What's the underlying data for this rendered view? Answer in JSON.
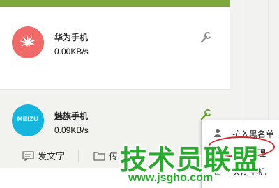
{
  "colors": {
    "accent_green": "#7fa83c",
    "huawei_red": "#f06a6a",
    "meizu_blue": "#15b5de",
    "highlight_red": "#d7262a",
    "watermark_green": "#2aa82f"
  },
  "devices": [
    {
      "name": "华为手机",
      "speed": "0.00KB/s",
      "logo_text": "",
      "icon": "huawei-logo-icon"
    },
    {
      "name": "魅族手机",
      "speed": "0.09KB/s",
      "logo_text": "MEIZU",
      "icon": "meizu-logo-icon"
    }
  ],
  "toolbar": {
    "send_text_label": "发文字",
    "transfer_label": "传"
  },
  "context_menu": {
    "items": [
      {
        "label": "拉入黑名单",
        "icon": "person-icon"
      },
      {
        "label": "设备管理",
        "icon": "gear-icon"
      },
      {
        "label": "关闭手机",
        "icon": "phone-icon"
      }
    ]
  },
  "watermark": {
    "title": "技术员联盟",
    "url": "www.jsgho.com"
  }
}
